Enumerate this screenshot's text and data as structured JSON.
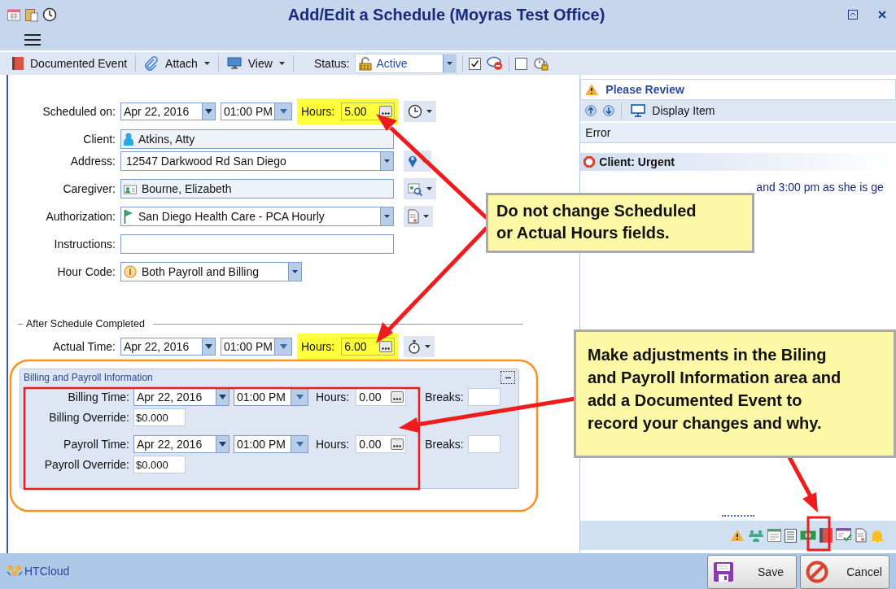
{
  "window": {
    "title": "Add/Edit a Schedule (Moyras Test Office)"
  },
  "toolbar": {
    "items": [
      {
        "label": "Documented Event",
        "kind": "event"
      },
      {
        "label": "Attach",
        "kind": "attach"
      },
      {
        "label": "View",
        "kind": "view"
      }
    ],
    "status_label": "Status:",
    "status_value": "Active",
    "confirm_checked": true,
    "lock_checked": false
  },
  "schedule": {
    "label": "Scheduled on:",
    "date": "Apr 22, 2016",
    "time": "01:00 PM",
    "hours_label": "Hours:",
    "hours": "5.00",
    "highlighted": true
  },
  "details": [
    {
      "label": "Client:",
      "value": "Atkins, Atty",
      "kind": "client"
    },
    {
      "label": "Address:",
      "value": "12547 Darkwood Rd San Diego",
      "kind": "address"
    },
    {
      "label": "Caregiver:",
      "value": "Bourne, Elizabeth",
      "kind": "caregiver"
    },
    {
      "label": "Authorization:",
      "value": "San Diego Health Care - PCA Hourly",
      "kind": "authorization"
    },
    {
      "label": "Instructions:",
      "kind": "text"
    },
    {
      "label": "Hour Code:",
      "value": "Both Payroll and Billing",
      "kind": "hourcode"
    }
  ],
  "after_group": {
    "title": "After Schedule Completed",
    "label": "Actual Time:",
    "date": "Apr 22, 2016",
    "time": "01:00 PM",
    "hours_label": "Hours:",
    "hours": "6.00",
    "highlighted": true
  },
  "billing_panel": {
    "title": "Billing and Payroll Information",
    "expanded": true,
    "rows": [
      {
        "label": "Billing Time:",
        "date": "Apr 22, 2016",
        "time": "01:00 PM",
        "hours_label": "Hours:",
        "hours": "0.00",
        "breaks_label": "Breaks:",
        "override_label": "Billing Override:",
        "override": "$0.000"
      },
      {
        "label": "Payroll Time:",
        "date": "Apr 22, 2016",
        "time": "01:00 PM",
        "hours_label": "Hours:",
        "hours": "0.00",
        "breaks_label": "Breaks:",
        "override_label": "Payroll Override:",
        "override": "$0.000"
      }
    ]
  },
  "review": {
    "title": "Please Review",
    "display_item": "Display Item",
    "column": "Error",
    "alert_title": "Client: Urgent",
    "message": "and 3:00 pm as she is ge"
  },
  "footer": {
    "brand": "HTCloud",
    "buttons": [
      {
        "label": "Save",
        "kind": "save"
      },
      {
        "label": "Cancel",
        "kind": "cancel"
      }
    ]
  },
  "callouts": [
    {
      "text": "Do not change Scheduled or Actual Hours fields."
    },
    {
      "text": "Make adjustments in the Biling and Payroll Information area and add a Documented Event to record your changes and why."
    }
  ]
}
